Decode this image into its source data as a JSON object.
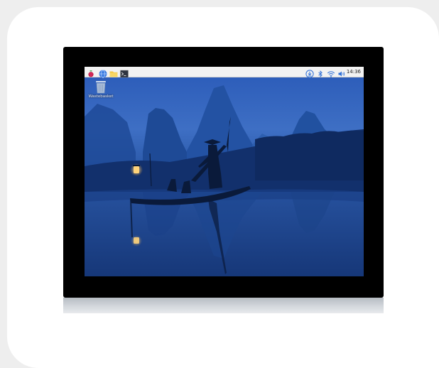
{
  "taskbar": {
    "launchers": [
      {
        "icon": "raspberry-menu-icon"
      },
      {
        "icon": "web-browser-globe-icon"
      },
      {
        "icon": "file-manager-folder-icon"
      },
      {
        "icon": "terminal-icon"
      }
    ],
    "tray": [
      {
        "icon": "update-download-icon"
      },
      {
        "icon": "bluetooth-icon"
      },
      {
        "icon": "wifi-icon"
      },
      {
        "icon": "volume-icon"
      }
    ],
    "clock": "14:36"
  },
  "desktop": {
    "icons": [
      {
        "icon": "wastebasket-icon",
        "label": "Wastebasket"
      }
    ]
  },
  "colors": {
    "bezel": "#000000",
    "taskbar": "#f2f2f2",
    "sky": "#2a58b4",
    "water": "#1b3f88",
    "accent_blue": "#3a7be0",
    "lantern": "#ffd37a"
  }
}
